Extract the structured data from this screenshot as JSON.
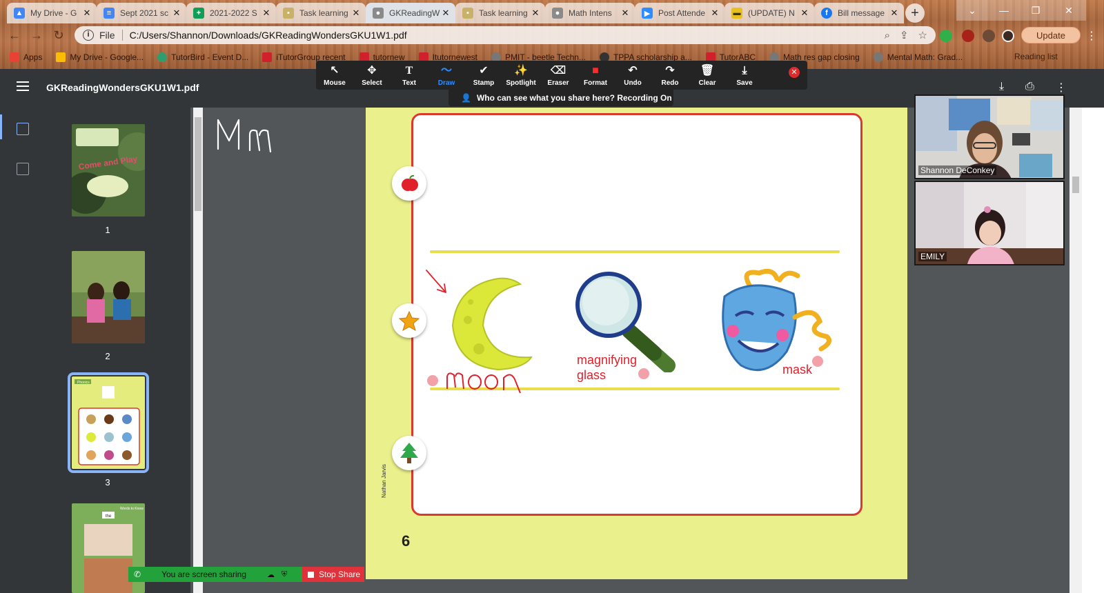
{
  "browser": {
    "tabs": [
      {
        "title": "My Drive - G",
        "color": "#4285f4",
        "letter": "▲"
      },
      {
        "title": "Sept 2021 sc",
        "color": "#4285f4",
        "letter": "≡"
      },
      {
        "title": "2021-2022 S",
        "color": "#0f9d58",
        "letter": "+"
      },
      {
        "title": "Task learning",
        "color": "#c8b26a",
        "letter": "▪"
      },
      {
        "title": "GKReadingW",
        "color": "#8a8a8a",
        "letter": "●"
      },
      {
        "title": "Task learning",
        "color": "#c8b26a",
        "letter": "▪"
      },
      {
        "title": "Math Intens",
        "color": "#8a8a8a",
        "letter": "●"
      },
      {
        "title": "Post Attende",
        "color": "#2d8cff",
        "letter": "▶"
      },
      {
        "title": "(UPDATE) N",
        "color": "#e8c020",
        "letter": "▬"
      },
      {
        "title": "Bill message",
        "color": "#1877f2",
        "letter": "f"
      }
    ],
    "address": {
      "scheme_label": "File",
      "url": "C:/Users/Shannon/Downloads/GKReadingWondersGKU1W1.pdf"
    },
    "update_label": "Update",
    "bookmarks": [
      {
        "label": "Apps",
        "color": "#e94235"
      },
      {
        "label": "My Drive - Google...",
        "color": "#fbbc04"
      },
      {
        "label": "TutorBird - Event D...",
        "color": "#2e9e6f"
      },
      {
        "label": "iTutorGroup recent",
        "color": "#d0202b"
      },
      {
        "label": "tutornew",
        "color": "#d0202b"
      },
      {
        "label": "Itutornewest",
        "color": "#d0202b"
      },
      {
        "label": "PMIT - beetle Techn...",
        "color": "#777777"
      },
      {
        "label": "TPPA scholarship a...",
        "color": "#333333"
      },
      {
        "label": "TutorABC",
        "color": "#d0202b"
      },
      {
        "label": "Math res gap closing",
        "color": "#777777"
      },
      {
        "label": "Mental Math: Grad...",
        "color": "#777777"
      }
    ],
    "reading_list": "Reading list"
  },
  "pdf": {
    "filename": "GKReadingWondersGKU1W1.pdf",
    "thumbnails": [
      {
        "num": "1",
        "thumb_text": "Come and Play"
      },
      {
        "num": "2"
      },
      {
        "num": "3",
        "thumb_text": "Phonics"
      },
      {
        "num": "",
        "thumb_text": "Words to Know",
        "word": "the"
      }
    ]
  },
  "zoom_toolbar": {
    "tools": [
      {
        "label": "Mouse",
        "icon": "↖"
      },
      {
        "label": "Select",
        "icon": "✥"
      },
      {
        "label": "Text",
        "icon": "T"
      },
      {
        "label": "Draw",
        "icon": "〜",
        "active": true
      },
      {
        "label": "Stamp",
        "icon": "✔"
      },
      {
        "label": "Spotlight",
        "icon": "✨"
      },
      {
        "label": "Eraser",
        "icon": "⌫"
      },
      {
        "label": "Format",
        "icon": "■"
      },
      {
        "label": "Undo",
        "icon": "↶"
      },
      {
        "label": "Redo",
        "icon": "↷"
      },
      {
        "label": "Clear",
        "icon": "🗑"
      },
      {
        "label": "Save",
        "icon": "⤓"
      }
    ],
    "recording_notice": "Who can see what you share here? Recording On"
  },
  "whiteboard": {
    "handwriting": "Mm"
  },
  "page_content": {
    "labels": {
      "moon": "moon",
      "magnifying": "magnifying",
      "glass": "glass",
      "mask": "mask"
    },
    "artist": "Nathan Jarvis",
    "page_number": "6"
  },
  "video": {
    "participants": [
      {
        "name": "Shannon DeConkey"
      },
      {
        "name": "EMILY"
      }
    ]
  },
  "share_bar": {
    "status": "You are screen sharing",
    "stop_label": "Stop Share"
  },
  "colors": {
    "accent": "#8ab4f8",
    "draw_active": "#2d8cff",
    "annotation_red": "#e0202b",
    "page_bg": "#eaf08b",
    "share_green": "#23a23b",
    "stop_red": "#e0323a"
  }
}
